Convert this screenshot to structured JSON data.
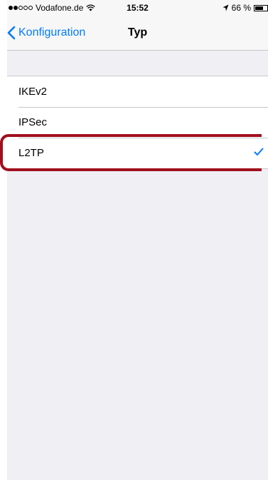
{
  "status_bar": {
    "carrier": "Vodafone.de",
    "time": "15:52",
    "battery_percent": "66 %",
    "battery_level": 0.66
  },
  "nav": {
    "back_label": "Konfiguration",
    "title": "Typ"
  },
  "list": {
    "items": [
      {
        "label": "IKEv2",
        "selected": false
      },
      {
        "label": "IPSec",
        "selected": false
      },
      {
        "label": "L2TP",
        "selected": true
      }
    ]
  },
  "colors": {
    "accent": "#007aff",
    "highlight": "#a10f1d",
    "background": "#efeff4"
  },
  "icons": {
    "back": "chevron-left-icon",
    "check": "checkmark-icon",
    "wifi": "wifi-icon",
    "location": "location-arrow-icon",
    "battery": "battery-icon"
  }
}
